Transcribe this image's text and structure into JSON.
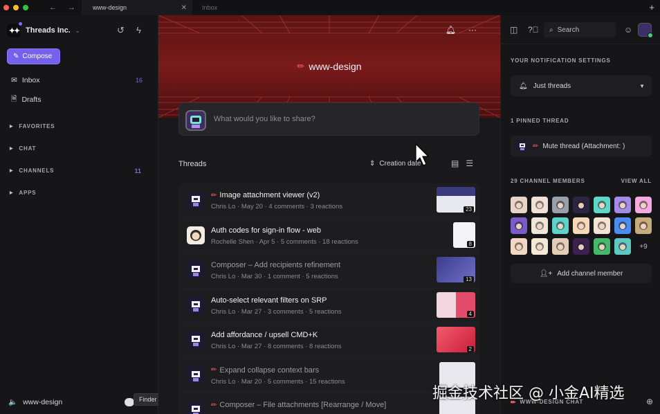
{
  "window": {
    "traffic_colors": [
      "#ff5f57",
      "#febc2e",
      "#28c840"
    ],
    "tabs": [
      {
        "label": "www-design",
        "active": true
      },
      {
        "label": "Inbox",
        "active": false
      }
    ]
  },
  "sidebar": {
    "workspace": "Threads Inc.",
    "compose_label": "Compose",
    "items": [
      {
        "label": "Inbox",
        "count": "16",
        "icon": "inbox-icon"
      },
      {
        "label": "Drafts",
        "count": "",
        "icon": "drafts-icon"
      }
    ],
    "sections": [
      {
        "label": "FAVORITES",
        "count": ""
      },
      {
        "label": "CHAT",
        "count": ""
      },
      {
        "label": "CHANNELS",
        "count": "11"
      },
      {
        "label": "APPS",
        "count": ""
      }
    ],
    "bottom_label": "www-design",
    "tooltip": "Finder"
  },
  "main": {
    "channel_title": "www-design",
    "composer_placeholder": "What would you like to share?",
    "threads_header": "Threads",
    "sort_label": "Creation date",
    "accent": "#7461ec",
    "threads": [
      {
        "title": "Image attachment viewer (v2)",
        "meta": "Chris Lo · May 20 · 4 comments · 3 reactions",
        "badge": "23",
        "pencil": true,
        "dim": false,
        "avatar": "robot",
        "thumb": "wide"
      },
      {
        "title": "Auth codes for sign-in flow - web",
        "meta": "Rochelle Shen · Apr 5 · 5 comments · 18 reactions",
        "badge": "8",
        "pencil": false,
        "dim": false,
        "avatar": "woman",
        "thumb": "doc"
      },
      {
        "title": "Composer – Add recipients refinement",
        "meta": "Chris Lo · Mar 30 · 1 comment · 5 reactions",
        "badge": "13",
        "pencil": false,
        "dim": true,
        "avatar": "robot",
        "thumb": "purple"
      },
      {
        "title": "Auto-select relevant filters on SRP",
        "meta": "Chris Lo · Mar 27 · 3 comments · 5 reactions",
        "badge": "4",
        "pencil": false,
        "dim": false,
        "avatar": "robot",
        "thumb": "pink"
      },
      {
        "title": "Add affordance / upsell CMD+K",
        "meta": "Chris Lo · Mar 27 · 8 comments · 8 reactions",
        "badge": "2",
        "pencil": false,
        "dim": false,
        "avatar": "robot",
        "thumb": "red"
      },
      {
        "title": "Expand collapse context bars",
        "meta": "Chris Lo · Mar 20 · 5 comments · 15 reactions",
        "badge": "",
        "pencil": true,
        "dim": true,
        "avatar": "robot",
        "thumb": "light"
      },
      {
        "title": "Composer – File attachments [Rearrange / Move]",
        "meta": "",
        "badge": "",
        "pencil": true,
        "dim": true,
        "avatar": "robot",
        "thumb": "light"
      }
    ]
  },
  "right": {
    "search_label": "Search",
    "notif_heading": "YOUR NOTIFICATION SETTINGS",
    "notif_value": "Just threads",
    "pinned_heading": "1 PINNED THREAD",
    "pinned_title": "Mute thread (Attachment: )",
    "members_heading": "29 CHANNEL MEMBERS",
    "view_all": "VIEW ALL",
    "members_more": "+9",
    "member_colors": [
      "#e8d4c9",
      "#f0e2d6",
      "#9aa0aa",
      "#2b2542",
      "#5fd6c6",
      "#a58be8",
      "#f6a8e0",
      "#7a5cc9",
      "#f0e6da",
      "#5ed1c9",
      "#f6d9b8",
      "#f3e3d3",
      "#4a8cf0",
      "#c8ab7a",
      "#f2d8c4",
      "#f3e7d6",
      "#e4cdb6",
      "#3a2150",
      "#46b86a",
      "#5fc9c0"
    ],
    "add_member_label": "Add channel member",
    "footer_label": "WWW-DESIGN CHAT"
  },
  "watermark": "掘金技术社区 @ 小金AI精选"
}
